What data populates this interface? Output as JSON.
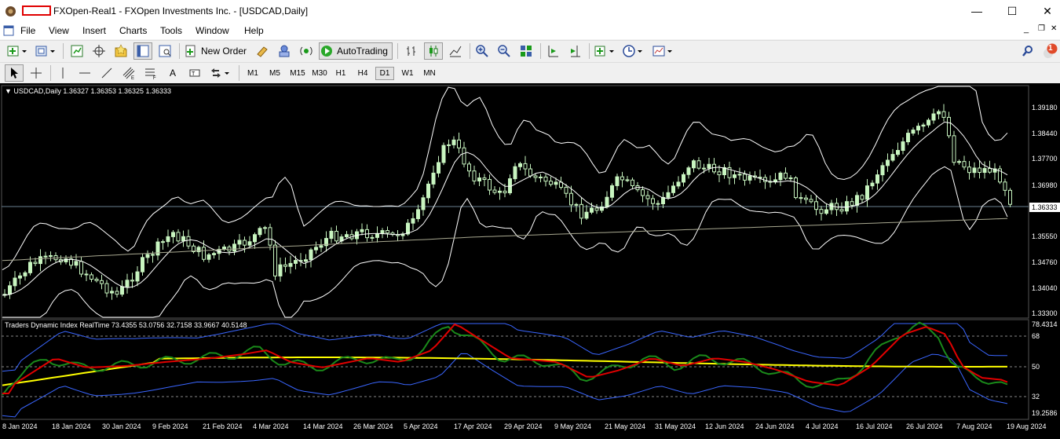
{
  "window": {
    "title": "FXOpen-Real1 - FXOpen Investments Inc. - [USDCAD,Daily]",
    "minimize": "—",
    "maximize": "☐",
    "close": "✕"
  },
  "menu": [
    "File",
    "View",
    "Insert",
    "Charts",
    "Tools",
    "Window",
    "Help"
  ],
  "toolbar": {
    "new_order": "New Order",
    "autotrading": "AutoTrading",
    "notification_count": "1"
  },
  "timeframes": [
    "M1",
    "M5",
    "M15",
    "M30",
    "H1",
    "H4",
    "D1",
    "W1",
    "MN"
  ],
  "active_timeframe": "D1",
  "chart": {
    "header": "USDCAD,Daily  1.36327 1.36353 1.36325 1.36333",
    "current_price": "1.36333",
    "price_axis": [
      "1.39180",
      "1.38440",
      "1.37700",
      "1.36980",
      "1.35550",
      "1.34760",
      "1.34040",
      "1.33300"
    ],
    "indicator_header": "Traders Dynamic Index RealTime 73.4355 53.0756 32.7158 33.9667 40.5148",
    "indicator_axis": [
      "78.4314",
      "68",
      "50",
      "32",
      "19.2586"
    ],
    "date_axis": [
      "8 Jan 2024",
      "18 Jan 2024",
      "30 Jan 2024",
      "9 Feb 2024",
      "21 Feb 2024",
      "4 Mar 2024",
      "14 Mar 2024",
      "26 Mar 2024",
      "5 Apr 2024",
      "17 Apr 2024",
      "29 Apr 2024",
      "9 May 2024",
      "21 May 2024",
      "31 May 2024",
      "12 Jun 2024",
      "24 Jun 2024",
      "4 Jul 2024",
      "16 Jul 2024",
      "26 Jul 2024",
      "7 Aug 2024",
      "19 Aug 2024"
    ],
    "colors": {
      "background": "#000000",
      "candle": "#c8f5c0",
      "bands": "#ffffff",
      "ma": "#a8a890",
      "tdi_green": "#1a8a1a",
      "tdi_red": "#e00000",
      "tdi_yellow": "#ffff00",
      "tdi_blue": "#3a66ff"
    }
  }
}
